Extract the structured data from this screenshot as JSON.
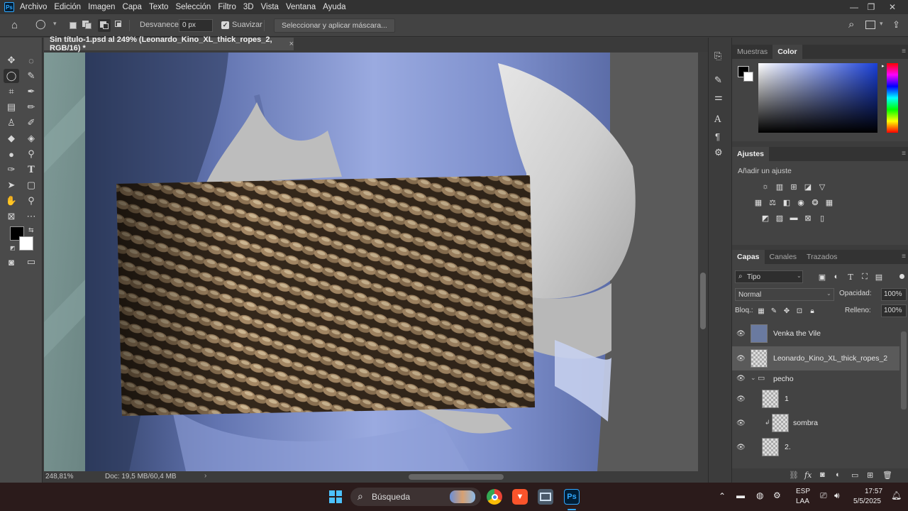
{
  "menubar": {
    "items": [
      "Archivo",
      "Edición",
      "Imagen",
      "Capa",
      "Texto",
      "Selección",
      "Filtro",
      "3D",
      "Vista",
      "Ventana",
      "Ayuda"
    ]
  },
  "options": {
    "feather_label": "Desvanecer:",
    "feather_value": "0 px",
    "smooth_label": "Suavizar",
    "smooth_checked": true,
    "select_mask_button": "Seleccionar y aplicar máscara..."
  },
  "document": {
    "tab_title": "Sin título-1.psd al 249% (Leonardo_Kino_XL_thick_ropes_2, RGB/16) *",
    "zoom": "248,81%",
    "doc_size": "Doc: 19,5 MB/60,4 MB"
  },
  "panels": {
    "swatch_tabs": [
      "Muestras",
      "Color"
    ],
    "swatch_active": "Color",
    "adjust_tab": "Ajustes",
    "adjust_subtitle": "Añadir un ajuste",
    "layer_tabs": [
      "Capas",
      "Canales",
      "Trazados"
    ],
    "layer_filter": "Tipo",
    "blend_mode": "Normal",
    "opacity_label": "Opacidad:",
    "opacity_value": "100%",
    "lock_label": "Bloq.:",
    "fill_label": "Relleno:",
    "fill_value": "100%"
  },
  "layers": [
    {
      "name": "Venka the Vile",
      "selected": false
    },
    {
      "name": "Leonardo_Kino_XL_thick_ropes_2",
      "selected": true
    },
    {
      "name": "pecho",
      "group": true
    },
    {
      "name": "1",
      "selected": false
    },
    {
      "name": "sombra",
      "selected": false,
      "clipped": true
    },
    {
      "name": "2.",
      "selected": false
    }
  ],
  "taskbar": {
    "search_placeholder": "Búsqueda",
    "lang_line1": "ESP",
    "lang_line2": "LAA",
    "time": "17:57",
    "date": "5/5/2025"
  },
  "colors": {
    "accent": "#31a8ff",
    "foreground_swatch": "#000000",
    "background_swatch": "#ffffff"
  }
}
